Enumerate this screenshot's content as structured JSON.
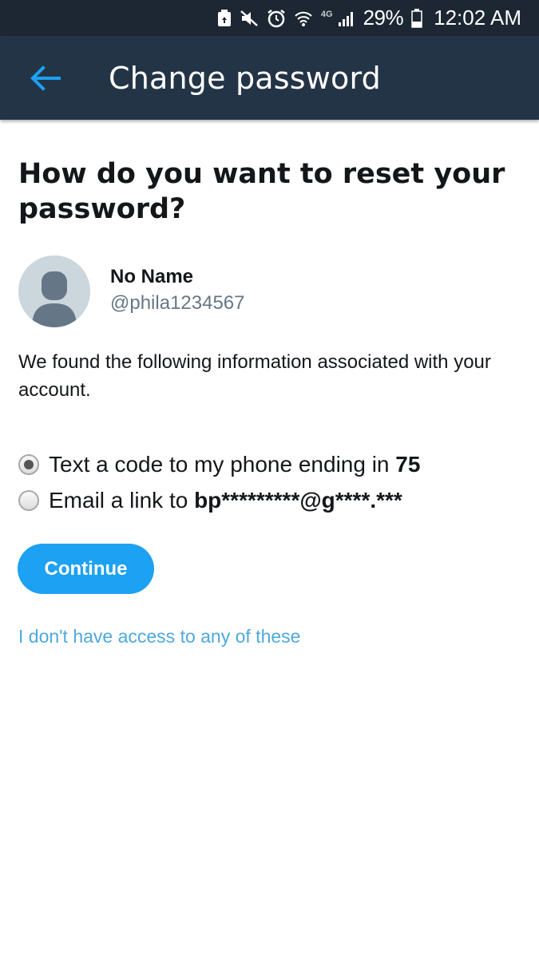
{
  "status_bar": {
    "network": "4G",
    "battery_percent": "29%",
    "time": "12:02 AM",
    "icons": [
      "battery-saver-icon",
      "mute-icon",
      "alarm-icon",
      "wifi-icon",
      "signal-icon",
      "battery-icon"
    ]
  },
  "app_bar": {
    "title": "Change password",
    "back_icon": "arrow-left-icon"
  },
  "page": {
    "heading": "How do you want to reset your password?",
    "user": {
      "display_name": "No Name",
      "username": "@phila1234567"
    },
    "info_text": "We found the following information associated with your account.",
    "options": [
      {
        "label_prefix": "Text a code to my phone ending in ",
        "label_bold": "75",
        "selected": true
      },
      {
        "label_prefix": "Email a link to ",
        "label_bold": "bp*********@g****.***",
        "selected": false
      }
    ],
    "continue_label": "Continue",
    "no_access_link": "I don't have access to any of these"
  },
  "colors": {
    "status_bar_bg": "#1c2733",
    "app_bar_bg": "#243447",
    "accent": "#1da1f2",
    "link": "#4ea8de",
    "muted_text": "#657786"
  }
}
